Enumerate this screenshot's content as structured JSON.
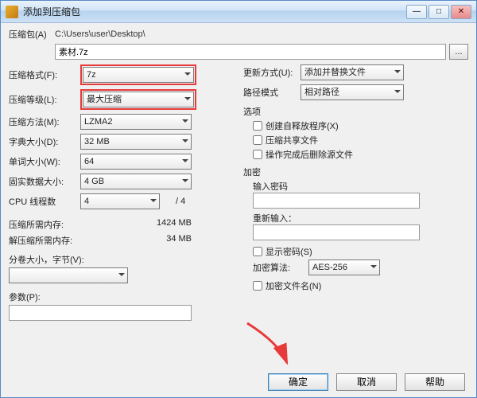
{
  "titlebar": {
    "title": "添加到压缩包"
  },
  "path": {
    "label": "压缩包(A)",
    "dir": "C:\\Users\\user\\Desktop\\",
    "file": "素材.7z",
    "browse": "..."
  },
  "left": {
    "format": {
      "label": "压缩格式(F):",
      "value": "7z"
    },
    "level": {
      "label": "压缩等级(L):",
      "value": "最大压缩"
    },
    "method": {
      "label": "压缩方法(M):",
      "value": "LZMA2"
    },
    "dict": {
      "label": "字典大小(D):",
      "value": "32 MB"
    },
    "word": {
      "label": "单词大小(W):",
      "value": "64"
    },
    "solid": {
      "label": "固实数据大小:",
      "value": "4 GB"
    },
    "threads": {
      "label": "CPU 线程数",
      "value": "4",
      "max": "/ 4"
    },
    "mem_comp": {
      "label": "压缩所需内存:",
      "value": "1424 MB"
    },
    "mem_decomp": {
      "label": "解压缩所需内存:",
      "value": "34 MB"
    },
    "split": {
      "label": "分卷大小，字节(V):"
    },
    "params": {
      "label": "参数(P):"
    }
  },
  "right": {
    "update": {
      "label": "更新方式(U):",
      "value": "添加并替换文件"
    },
    "pathmode": {
      "label": "路径模式",
      "value": "相对路径"
    },
    "options": {
      "title": "选项",
      "sfx": "创建自释放程序(X)",
      "share": "压缩共享文件",
      "delete": "操作完成后删除源文件"
    },
    "encrypt": {
      "title": "加密",
      "pw1": "输入密码",
      "pw2": "重新输入：",
      "show": "显示密码(S)",
      "algo_label": "加密算法:",
      "algo": "AES-256",
      "encnames": "加密文件名(N)"
    }
  },
  "buttons": {
    "ok": "确定",
    "cancel": "取消",
    "help": "帮助"
  }
}
